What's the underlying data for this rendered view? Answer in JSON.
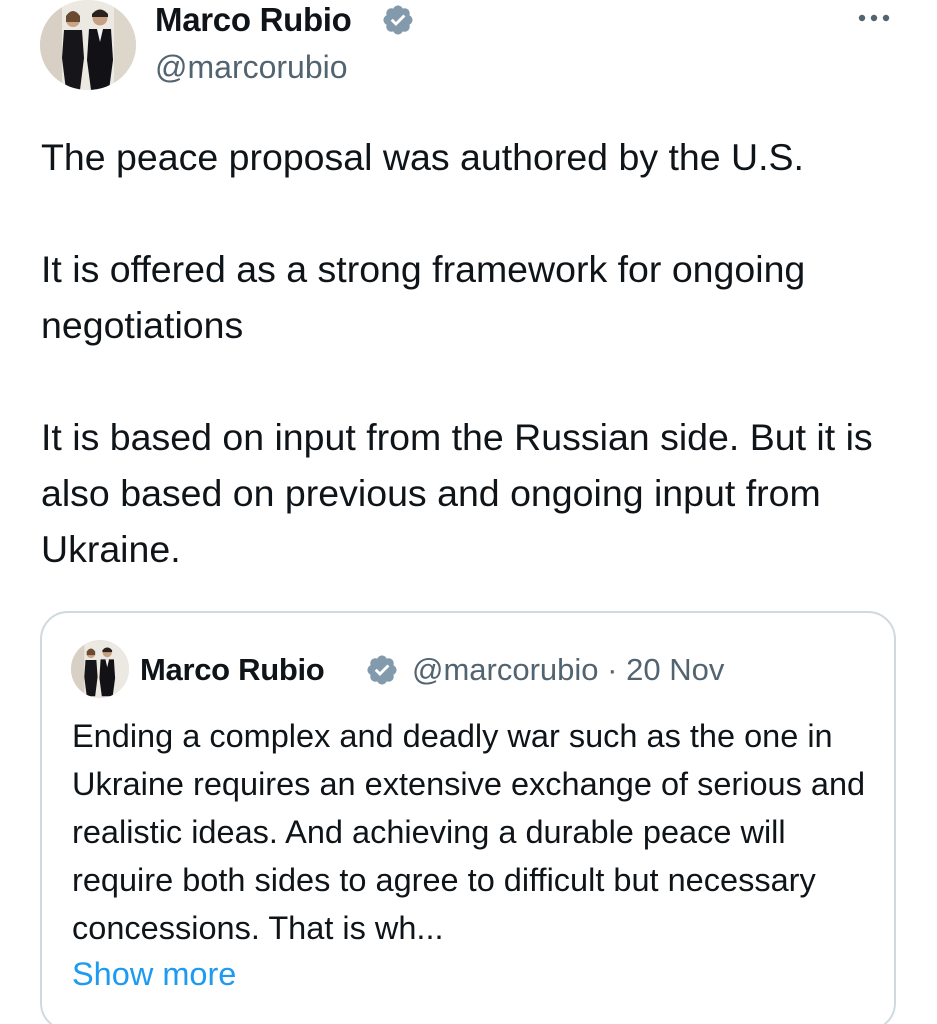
{
  "tweet": {
    "author_name": "Marco Rubio",
    "handle": "@marcorubio",
    "paragraphs": [
      "The peace proposal was authored by the U.S.",
      "It is offered as a strong framework for ongoing negotiations",
      "It is based on input from the Russian side. But it is also based on previous and ongoing input from Ukraine."
    ],
    "icons": {
      "verified": "verified-badge-icon",
      "more": "more-options-icon",
      "avatar": "profile-avatar"
    }
  },
  "quote": {
    "author_name": "Marco Rubio",
    "handle": "@marcorubio",
    "separator": "·",
    "date": "20 Nov",
    "text": "Ending a complex and deadly war such as the one in Ukraine requires an extensive exchange of serious and realistic ideas. And achieving a durable peace will require both sides to agree to difficult but necessary concessions. That is wh...",
    "show_more_label": "Show more"
  },
  "colors": {
    "text": "#0f1419",
    "secondary_text": "#536471",
    "link": "#1d9bf0",
    "verified_badge": "#829aab",
    "card_border": "#cfd9de",
    "background": "#ffffff"
  }
}
